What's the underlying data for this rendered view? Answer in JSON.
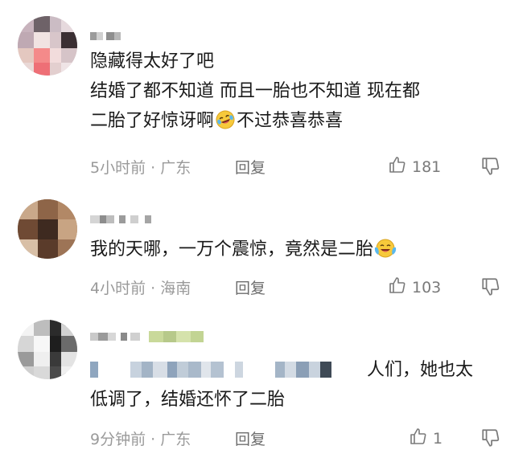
{
  "comments": [
    {
      "lines": [
        "隐藏得太好了吧",
        "结婚了都不知道 而且一胎也不知道 现在都"
      ],
      "line3_pre": "二胎了好惊讶啊",
      "line3_post": "不过恭喜恭喜",
      "emoji": "laughing-crying-emoji",
      "time": "5小时前",
      "dot": "·",
      "location": "广东",
      "reply_label": "回复",
      "likes": "181"
    },
    {
      "line1_pre": "我的天哪，一万个震惊，竟然是二胎",
      "emoji": "crying-laughing-emoji",
      "time": "4小时前",
      "dot": "·",
      "location": "海南",
      "reply_label": "回复",
      "likes": "103"
    },
    {
      "line1_post": "人们，她也太",
      "line2": "低调了，结婚还怀了二胎",
      "time": "9分钟前",
      "dot": "·",
      "location": "广东",
      "reply_label": "回复",
      "likes": "1"
    }
  ],
  "colors": {
    "text": "#1a1a1a",
    "meta": "#9a9a9a",
    "icon": "#7a7a7a"
  }
}
